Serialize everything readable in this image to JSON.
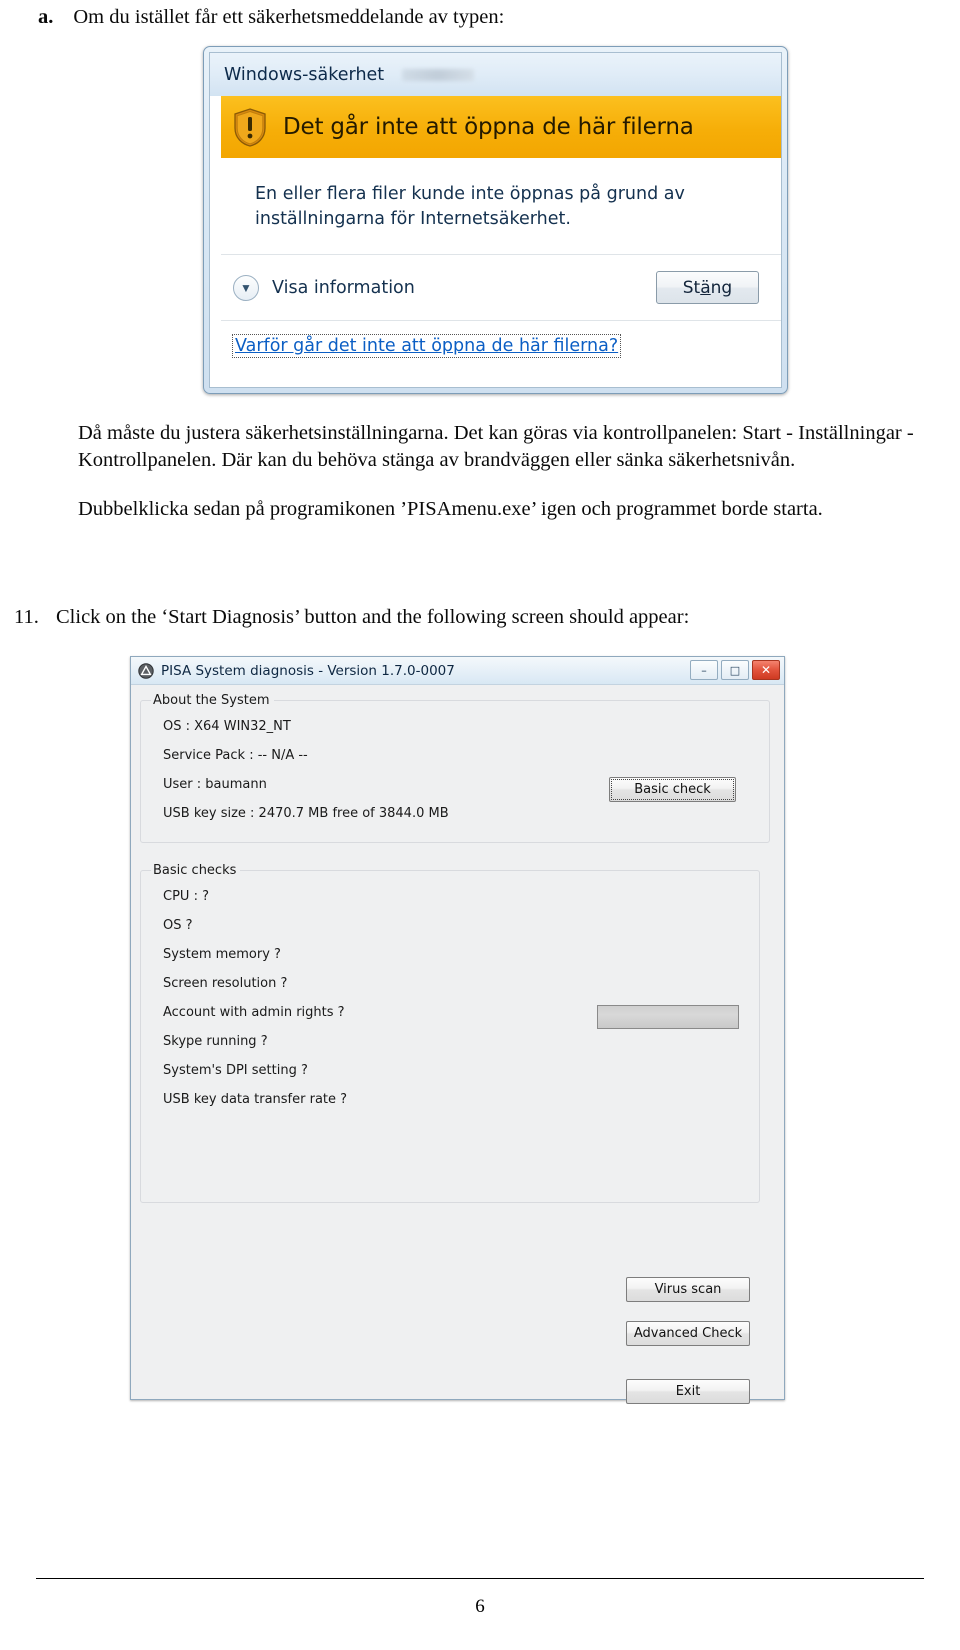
{
  "document": {
    "page_number": "6",
    "item_a": {
      "marker": "a.",
      "text": "Om du istället får ett säkerhetsmeddelande av typen:"
    },
    "paragraphs": [
      "Då måste du justera säkerhetsinställningarna. Det kan göras via kontrollpanelen: Start - Inställningar - Kontrollpanelen. Där kan du behöva stänga av brandväggen eller sänka säkerhetsnivån.",
      "Dubbelklicka sedan på programikonen ’PISAmenu.exe’ igen och programmet borde starta."
    ],
    "item_11": {
      "marker": "11.",
      "text": "Click on the ‘Start Diagnosis’ button and the following screen should appear:"
    }
  },
  "windows_security_dialog": {
    "title": "Windows-säkerhet",
    "banner_heading": "Det går inte att öppna de här filerna",
    "banner_icon": "warning-shield-icon",
    "message": "En eller flera filer kunde inte öppnas på grund av inställningarna för Internetsäkerhet.",
    "show_details_label": "Visa information",
    "show_details_icon": "chevron-down-icon",
    "close_button": "Stäng",
    "help_link": "Varför går det inte att öppna de här filerna?",
    "colors": {
      "banner": "#f6ae08",
      "link": "#0b5ec4",
      "title_bar": "#e0ecf7"
    }
  },
  "pisa_window": {
    "title": "PISA System diagnosis - Version 1.7.0-0007",
    "app_icon": "pisa-app-icon",
    "window_buttons": {
      "minimize": "–",
      "maximize": "□",
      "close": "✕"
    },
    "about_group": {
      "legend": "About the System",
      "rows": [
        "OS  : X64 WIN32_NT",
        "Service Pack   : -- N/A --",
        "User : baumann",
        "USB key size : 2470.7 MB free of 3844.0 MB"
      ]
    },
    "basic_group": {
      "legend": "Basic checks",
      "rows": [
        "CPU : ?",
        "OS ?",
        "System memory ?",
        "Screen resolution ?",
        "Account with admin rights ?",
        "Skype running ?",
        "System's DPI setting ?",
        "USB key data transfer rate ?"
      ],
      "basic_check_button": "Basic check",
      "transfer_rate_progress": ""
    },
    "buttons": {
      "virus_scan": "Virus scan",
      "advanced_check": "Advanced Check",
      "exit": "Exit"
    }
  }
}
